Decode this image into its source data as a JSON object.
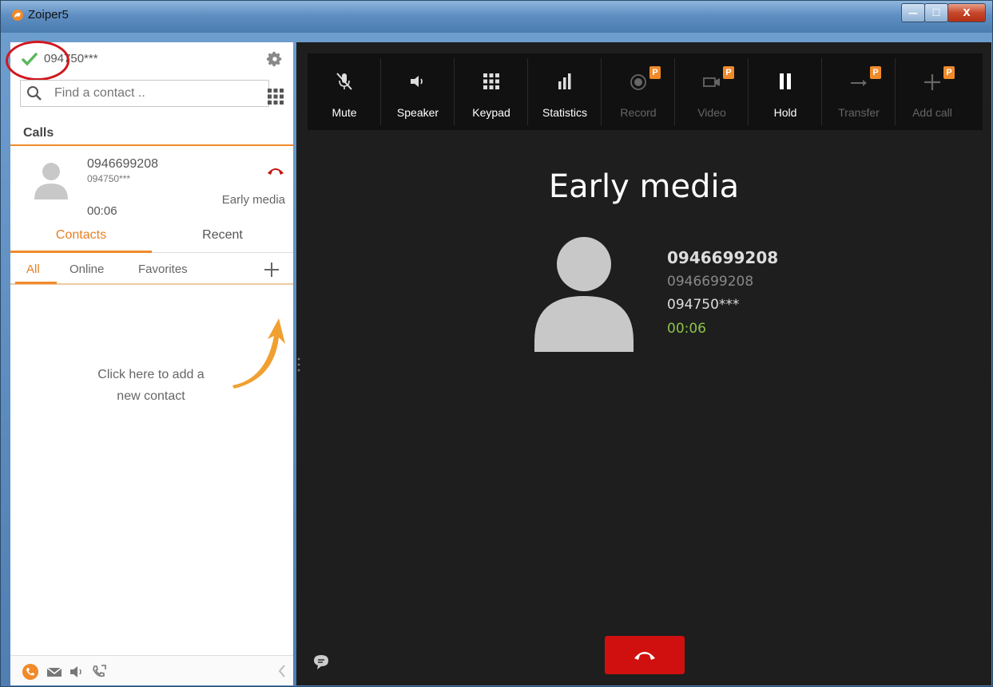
{
  "window": {
    "title": "Zoiper5",
    "min_symbol": "—",
    "max_symbol": "☐",
    "close_symbol": "X"
  },
  "account": {
    "name": "094750***",
    "status_icon": "check-icon",
    "status_color": "#5cb85c"
  },
  "search": {
    "placeholder": "Find a contact .."
  },
  "calls": {
    "heading": "Calls",
    "items": [
      {
        "number": "0946699208",
        "account": "094750***",
        "duration": "00:06",
        "state": "Early media"
      }
    ]
  },
  "tabs": [
    {
      "label": "Contacts",
      "active": true
    },
    {
      "label": "Recent",
      "active": false
    }
  ],
  "subtabs": [
    {
      "label": "All",
      "active": true
    },
    {
      "label": "Online"
    },
    {
      "label": "Favorites"
    }
  ],
  "empty_hint": {
    "line1": "Click here to add a",
    "line2": "new contact"
  },
  "toolbar": [
    {
      "label": "Mute",
      "icon": "mic-off-icon",
      "enabled": true,
      "premium": false
    },
    {
      "label": "Speaker",
      "icon": "speaker-icon",
      "enabled": true,
      "premium": false
    },
    {
      "label": "Keypad",
      "icon": "keypad-icon",
      "enabled": true,
      "premium": false
    },
    {
      "label": "Statistics",
      "icon": "statistics-icon",
      "enabled": true,
      "premium": false
    },
    {
      "label": "Record",
      "icon": "record-icon",
      "enabled": false,
      "premium": true
    },
    {
      "label": "Video",
      "icon": "video-icon",
      "enabled": false,
      "premium": true
    },
    {
      "label": "Hold",
      "icon": "pause-icon",
      "enabled": true,
      "premium": false
    },
    {
      "label": "Transfer",
      "icon": "transfer-icon",
      "enabled": false,
      "premium": true
    },
    {
      "label": "Add call",
      "icon": "add-call-icon",
      "enabled": false,
      "premium": true
    }
  ],
  "premium_badge": "P",
  "active_call": {
    "state": "Early media",
    "name": "0946699208",
    "number": "0946699208",
    "account": "094750***",
    "duration": "00:06"
  },
  "colors": {
    "accent": "#f08a2a",
    "hangup": "#d0100e",
    "timer": "#8bc34a",
    "dark_bg": "#1e1e1e"
  }
}
